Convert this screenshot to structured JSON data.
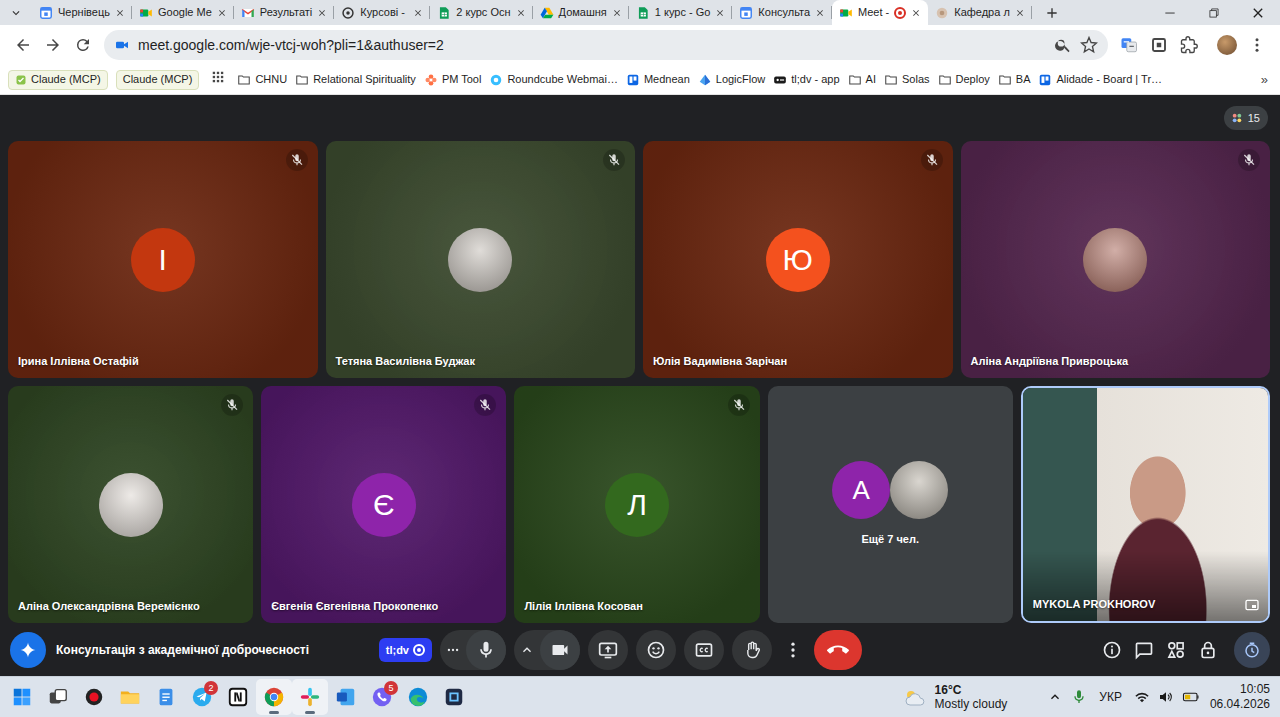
{
  "browser": {
    "tabs": [
      {
        "label": "Чернівець",
        "kind": "calendar",
        "selected": false
      },
      {
        "label": "Google Me",
        "kind": "meet",
        "selected": false
      },
      {
        "label": "Результаті",
        "kind": "gmail",
        "selected": false
      },
      {
        "label": "Курсові - ",
        "kind": "openai",
        "selected": false
      },
      {
        "label": "2 курс Осн",
        "kind": "sheets",
        "selected": false
      },
      {
        "label": "Домашня",
        "kind": "drive",
        "selected": false
      },
      {
        "label": "1 курс - Go",
        "kind": "sheets",
        "selected": false
      },
      {
        "label": "Консульта",
        "kind": "calendar",
        "selected": false
      },
      {
        "label": "Meet - ",
        "kind": "meet",
        "selected": true,
        "recording": true
      },
      {
        "label": "Кафедра л",
        "kind": "site",
        "selected": false
      }
    ],
    "address": "meet.google.com/wje-vtcj-woh?pli=1&authuser=2",
    "bookmarks": {
      "pinned": [
        {
          "label": "Claude (MCP)",
          "kind": "icon"
        },
        {
          "label": "Claude (MCP)",
          "kind": "plain"
        }
      ],
      "items": [
        {
          "label": "CHNU",
          "kind": "folder"
        },
        {
          "label": "Relational Spirituality",
          "kind": "folder"
        },
        {
          "label": "PM Tool",
          "kind": "pm"
        },
        {
          "label": "Roundcube Webmai…",
          "kind": "roundcube"
        },
        {
          "label": "Mednean",
          "kind": "trello"
        },
        {
          "label": "LogicFlow",
          "kind": "logicflow"
        },
        {
          "label": "tl;dv - app",
          "kind": "tldv"
        },
        {
          "label": "AI",
          "kind": "folder"
        },
        {
          "label": "Solas",
          "kind": "folder"
        },
        {
          "label": "Deploy",
          "kind": "folder"
        },
        {
          "label": "BA",
          "kind": "folder"
        },
        {
          "label": "Alidade - Board | Tr…",
          "kind": "trello"
        }
      ],
      "more": "»"
    }
  },
  "meet": {
    "participant_count": "15",
    "rows": [
      [
        {
          "name": "Ірина Іллівна Остафій",
          "kind": "initial",
          "initial": "І",
          "muted": true,
          "color": "#6c2710",
          "avatar_color": "#c3370f"
        },
        {
          "name": "Тетяна Василівна Буджак",
          "kind": "photo",
          "muted": true,
          "color": "#3b4a2e",
          "avatar_color": "#cfcac4"
        },
        {
          "name": "Юлія Вадимівна Зарічан",
          "kind": "initial",
          "initial": "Ю",
          "muted": true,
          "color": "#6c2710",
          "avatar_color": "#f4511e"
        },
        {
          "name": "Аліна Андріївна Привроцька",
          "kind": "photo",
          "muted": true,
          "color": "#55264f",
          "avatar_color": "#b98378"
        }
      ],
      [
        {
          "name": "Аліна Олександрівна Веремієнко",
          "kind": "photo",
          "muted": true,
          "color": "#2e4522",
          "avatar_color": "#e4dfda"
        },
        {
          "name": "Євгенія Євгенівна Прокопенко",
          "kind": "initial",
          "initial": "Є",
          "muted": true,
          "color": "#52186a",
          "avatar_color": "#8e24aa"
        },
        {
          "name": "Лілія Іллівна Косован",
          "kind": "initial",
          "initial": "Л",
          "muted": true,
          "color": "#2a481c",
          "avatar_color": "#33691e"
        }
      ]
    ],
    "overflow": {
      "initial": "А",
      "label": "Ещё 7 чел.",
      "avatar_color": "#8e24aa",
      "photo_color": "#c9c4bb"
    },
    "self": {
      "name": "MYKOLA PROKHOROV",
      "kind": "video"
    },
    "meeting_title": "Консультація з академічної доброчесності",
    "recorder": {
      "label": "tl;dv",
      "recording": true
    }
  },
  "taskbar": {
    "apps": [
      {
        "kind": "start",
        "selected": false
      },
      {
        "kind": "taskview",
        "selected": false
      },
      {
        "kind": "recorder",
        "selected": false
      },
      {
        "kind": "explorer",
        "selected": false
      },
      {
        "kind": "notepad",
        "selected": false
      },
      {
        "kind": "telegram",
        "selected": false,
        "badge": "2"
      },
      {
        "kind": "notion",
        "selected": false
      },
      {
        "kind": "chrome",
        "selected": true
      },
      {
        "kind": "slack",
        "selected": true
      },
      {
        "kind": "word",
        "selected": false
      },
      {
        "kind": "viber",
        "selected": false,
        "badge": "5"
      },
      {
        "kind": "edge",
        "selected": false
      },
      {
        "kind": "app",
        "selected": false
      }
    ],
    "weather": {
      "temp": "16°C",
      "text": "Mostly cloudy"
    },
    "language": "УКР",
    "time": "10:05",
    "date": "06.04.2026"
  }
}
